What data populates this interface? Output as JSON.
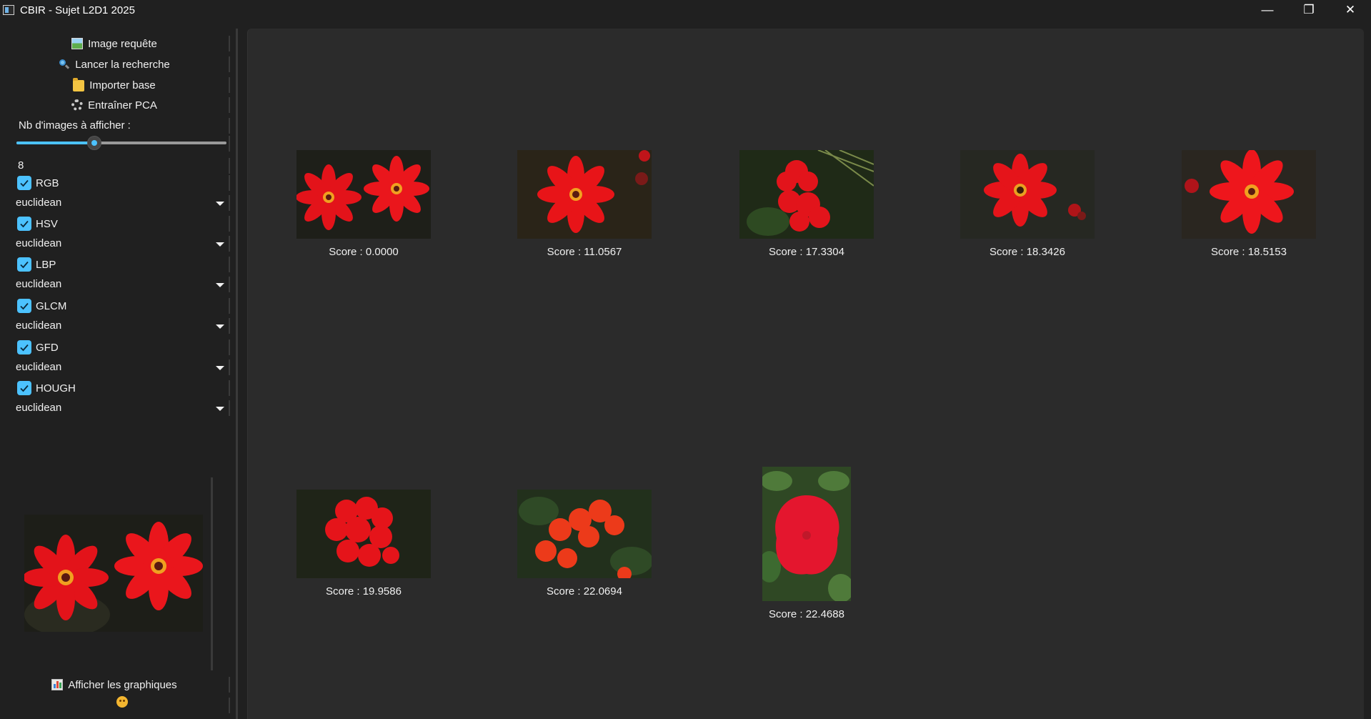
{
  "window": {
    "title": "CBIR - Sujet L2D1 2025",
    "minimize_glyph": "—",
    "maximize_glyph": "❐",
    "close_glyph": "✕"
  },
  "sidebar": {
    "buttons": {
      "query_image": "Image requête",
      "search": "Lancer la recherche",
      "import": "Importer base",
      "train_pca": "Entraîner PCA",
      "show_charts": "Afficher les graphiques"
    },
    "nb_label": "Nb d'images à afficher :",
    "slider_value": 8,
    "slider_fraction": 0.37,
    "descriptors": [
      {
        "label": "RGB",
        "checked": true,
        "metric": "euclidean"
      },
      {
        "label": "HSV",
        "checked": true,
        "metric": "euclidean"
      },
      {
        "label": "LBP",
        "checked": true,
        "metric": "euclidean"
      },
      {
        "label": "GLCM",
        "checked": true,
        "metric": "euclidean"
      },
      {
        "label": "GFD",
        "checked": true,
        "metric": "euclidean"
      },
      {
        "label": "HOUGH",
        "checked": true,
        "metric": "euclidean"
      }
    ]
  },
  "results": [
    {
      "score": "Score : 0.0000"
    },
    {
      "score": "Score : 11.0567"
    },
    {
      "score": "Score : 17.3304"
    },
    {
      "score": "Score : 18.3426"
    },
    {
      "score": "Score : 18.5153"
    },
    {
      "score": "Score : 19.9586"
    },
    {
      "score": "Score : 22.0694"
    },
    {
      "score": "Score : 22.4688"
    }
  ],
  "colors": {
    "accent": "#4cc2ff",
    "background": "#202020",
    "panel": "#2b2b2b",
    "flower_red": "#e8141b"
  }
}
